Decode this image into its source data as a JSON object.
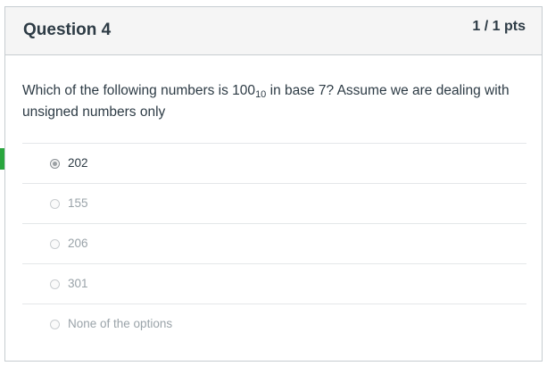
{
  "question": {
    "title": "Question 4",
    "points": "1 / 1 pts",
    "text_before": "Which of the following numbers is 100",
    "text_subscript": "10",
    "text_after": " in base 7? Assume we are dealing with unsigned numbers only"
  },
  "answers": [
    {
      "label": "202",
      "selected": true
    },
    {
      "label": "155",
      "selected": false
    },
    {
      "label": "206",
      "selected": false
    },
    {
      "label": "301",
      "selected": false
    },
    {
      "label": "None of the options",
      "selected": false
    }
  ],
  "colors": {
    "correct_marker": "#2aa63e",
    "text": "#2d3b45",
    "muted_text": "#9aa3a9",
    "header_bg": "#f5f5f5"
  },
  "icons": {
    "correct_marker": "correct-answer-arrow-icon"
  }
}
